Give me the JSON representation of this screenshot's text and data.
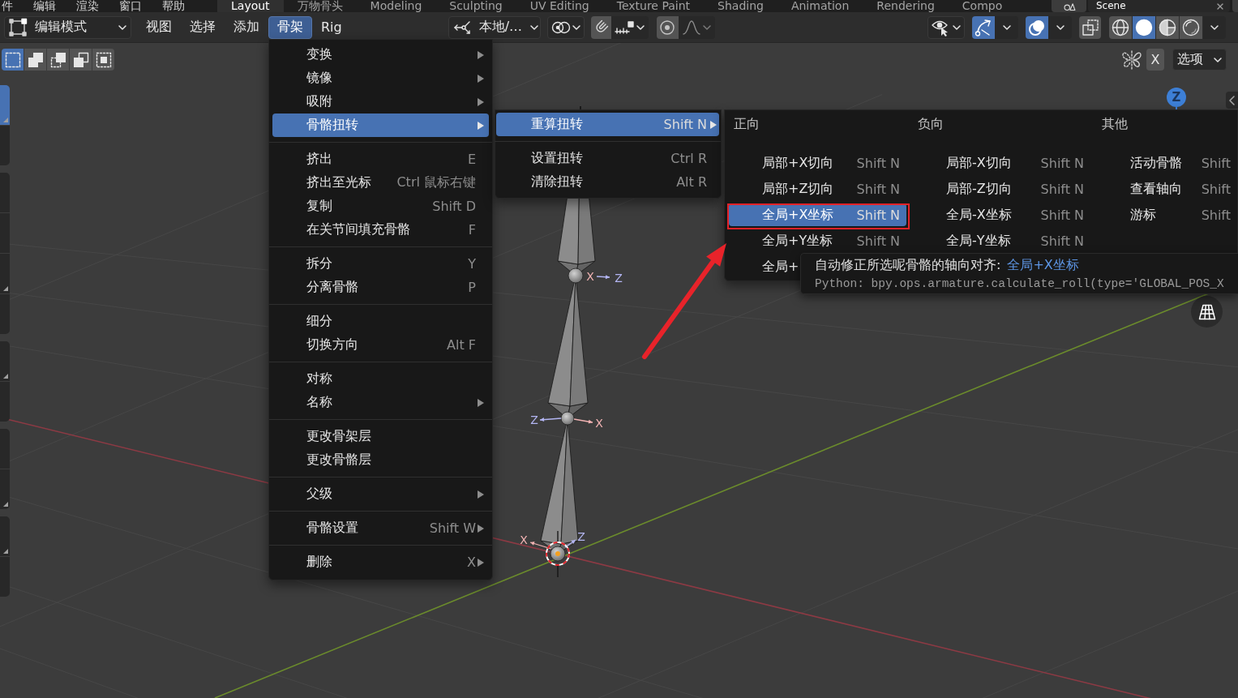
{
  "topbar": {
    "menus": [
      "件",
      "编辑",
      "渲染",
      "窗口",
      "帮助"
    ],
    "workspaces": [
      {
        "label": "Layout",
        "selected": true
      },
      {
        "label": "万物骨头",
        "selected": false
      },
      {
        "label": "Modeling",
        "selected": false
      },
      {
        "label": "Sculpting",
        "selected": false
      },
      {
        "label": "UV Editing",
        "selected": false
      },
      {
        "label": "Texture Paint",
        "selected": false
      },
      {
        "label": "Shading",
        "selected": false
      },
      {
        "label": "Animation",
        "selected": false
      },
      {
        "label": "Rendering",
        "selected": false
      },
      {
        "label": "Compo",
        "selected": false
      }
    ],
    "scene": "Scene"
  },
  "header": {
    "mode": "编辑模式",
    "menus": [
      {
        "label": "视图",
        "selected": false
      },
      {
        "label": "选择",
        "selected": false
      },
      {
        "label": "添加",
        "selected": false
      },
      {
        "label": "骨架",
        "selected": true
      },
      {
        "label": "Rig",
        "selected": false
      }
    ],
    "orientation": "本地/…",
    "snap": {
      "on": false
    },
    "proportional": {
      "on": false
    },
    "gizmos": {
      "on": true
    },
    "overlays": {
      "on": true
    },
    "xray": {
      "on": false
    },
    "shading": [
      {
        "kind": "wireframe",
        "selected": false
      },
      {
        "kind": "solid",
        "selected": true
      },
      {
        "kind": "material",
        "selected": false
      },
      {
        "kind": "rendered",
        "selected": false
      }
    ]
  },
  "tool_settings": {
    "select_modes": [
      {
        "kind": "set",
        "selected": true
      },
      {
        "kind": "extend",
        "selected": false
      },
      {
        "kind": "subtract",
        "selected": false
      },
      {
        "kind": "invert",
        "selected": false
      },
      {
        "kind": "intersect",
        "selected": false
      }
    ],
    "mirror_x": {
      "label": "X",
      "on": false
    },
    "options": "选项"
  },
  "toolbar": {
    "groups": [
      [
        {
          "selected": true,
          "more": true
        },
        {
          "selected": false,
          "more": false
        }
      ],
      [
        {
          "selected": false,
          "more": false
        },
        {
          "selected": false,
          "more": false
        },
        {
          "selected": false,
          "more": true
        },
        {
          "selected": false,
          "more": false
        }
      ],
      [
        {
          "selected": false,
          "more": true
        },
        {
          "selected": false,
          "more": false
        }
      ],
      [
        {
          "selected": false,
          "more": false
        },
        {
          "selected": false,
          "more": true
        }
      ],
      [
        {
          "selected": false,
          "more": true
        },
        {
          "selected": false,
          "more": false
        }
      ]
    ]
  },
  "viewport": {
    "nav_axis": "Z",
    "axis_labels": [
      "X",
      "Z",
      "Z",
      "X",
      "X",
      "Z"
    ]
  },
  "armature_menu": {
    "groups": [
      [
        {
          "label": "变换",
          "submenu": true,
          "selected": false
        },
        {
          "label": "镜像",
          "submenu": true,
          "selected": false
        },
        {
          "label": "吸附",
          "submenu": true,
          "selected": false
        },
        {
          "label": "骨骼扭转",
          "submenu": true,
          "selected": true
        }
      ],
      [
        {
          "label": "挤出",
          "shortcut": "E",
          "submenu": false,
          "selected": false
        },
        {
          "label": "挤出至光标",
          "shortcut": "Ctrl 鼠标右键",
          "submenu": false,
          "selected": false
        },
        {
          "label": "复制",
          "shortcut": "Shift D",
          "submenu": false,
          "selected": false
        },
        {
          "label": "在关节间填充骨骼",
          "shortcut": "F",
          "submenu": false,
          "selected": false
        }
      ],
      [
        {
          "label": "拆分",
          "shortcut": "Y",
          "submenu": false,
          "selected": false
        },
        {
          "label": "分离骨骼",
          "shortcut": "P",
          "submenu": false,
          "selected": false
        }
      ],
      [
        {
          "label": "细分",
          "submenu": false,
          "selected": false
        },
        {
          "label": "切换方向",
          "shortcut": "Alt F",
          "submenu": false,
          "selected": false
        }
      ],
      [
        {
          "label": "对称",
          "submenu": false,
          "selected": false
        },
        {
          "label": "名称",
          "submenu": true,
          "selected": false
        }
      ],
      [
        {
          "label": "更改骨架层",
          "submenu": false,
          "selected": false
        },
        {
          "label": "更改骨骼层",
          "submenu": false,
          "selected": false
        }
      ],
      [
        {
          "label": "父级",
          "submenu": true,
          "selected": false
        }
      ],
      [
        {
          "label": "骨骼设置",
          "shortcut": "Shift W",
          "submenu": true,
          "selected": false
        }
      ],
      [
        {
          "label": "删除",
          "shortcut": "X",
          "submenu": true,
          "selected": false
        }
      ]
    ]
  },
  "roll_menu": {
    "groups": [
      [
        {
          "label": "重算扭转",
          "shortcut": "Shift N",
          "submenu": true,
          "selected": true
        }
      ],
      [
        {
          "label": "设置扭转",
          "shortcut": "Ctrl R",
          "submenu": false,
          "selected": false
        },
        {
          "label": "清除扭转",
          "shortcut": "Alt R",
          "submenu": false,
          "selected": false
        }
      ]
    ]
  },
  "recalc_menu": {
    "columns": [
      {
        "heading": "正向",
        "items": [
          {
            "label": "局部+X切向",
            "shortcut": "Shift N",
            "selected": false
          },
          {
            "label": "局部+Z切向",
            "shortcut": "Shift N",
            "selected": false
          },
          {
            "label": "全局+X坐标",
            "shortcut": "Shift N",
            "selected": true
          },
          {
            "label": "全局+Y坐标",
            "shortcut": "Shift N",
            "selected": false
          },
          {
            "label": "全局+",
            "selected": false
          }
        ]
      },
      {
        "heading": "负向",
        "items": [
          {
            "label": "局部-X切向",
            "shortcut": "Shift N",
            "selected": false
          },
          {
            "label": "局部-Z切向",
            "shortcut": "Shift N",
            "selected": false
          },
          {
            "label": "全局-X坐标",
            "shortcut": "Shift N",
            "selected": false
          },
          {
            "label": "全局-Y坐标",
            "shortcut": "Shift N",
            "selected": false
          }
        ]
      },
      {
        "heading": "其他",
        "items": [
          {
            "label": "活动骨骼",
            "shortcut": "Shift",
            "selected": false
          },
          {
            "label": "查看轴向",
            "shortcut": "Shift",
            "selected": false
          },
          {
            "label": "游标",
            "shortcut": "Shift",
            "selected": false
          }
        ]
      }
    ]
  },
  "tooltip": {
    "description": "自动修正所选呢骨骼的轴向对齐:",
    "value": "全局+X坐标",
    "python": "Python: bpy.ops.armature.calculate_roll(type='GLOBAL_POS_X"
  }
}
